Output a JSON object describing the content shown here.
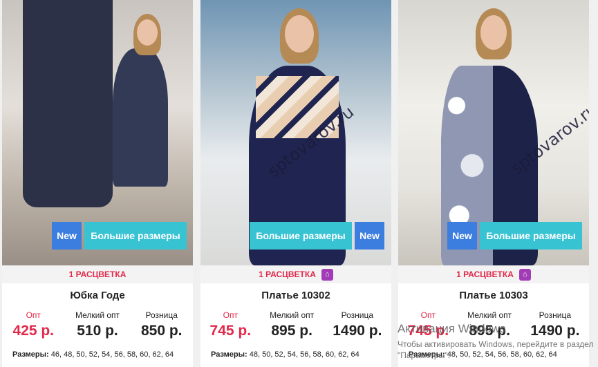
{
  "products": [
    {
      "title": "Юбка Годе",
      "watermark": "",
      "badges": {
        "new": "New",
        "big": "Большие размеры"
      },
      "colors": "1 РАСЦВЕТКА",
      "prices": [
        {
          "label": "Опт",
          "value": "425 р."
        },
        {
          "label": "Мелкий опт",
          "value": "510 р."
        },
        {
          "label": "Розница",
          "value": "850 р."
        }
      ],
      "sizes_label": "Размеры:",
      "sizes": "46, 48, 50, 52, 54, 56, 58, 60, 62, 64"
    },
    {
      "title": "Платье 10302",
      "watermark": "sptovarov.ru",
      "badges": {
        "new": "New",
        "big": "Большие размеры"
      },
      "colors": "1 РАСЦВЕТКА",
      "prices": [
        {
          "label": "Опт",
          "value": "745 р."
        },
        {
          "label": "Мелкий опт",
          "value": "895 р."
        },
        {
          "label": "Розница",
          "value": "1490 р."
        }
      ],
      "sizes_label": "Размеры:",
      "sizes": "48, 50, 52, 54, 56, 58, 60, 62, 64"
    },
    {
      "title": "Платье 10303",
      "watermark": "sptovarov.ru",
      "badges": {
        "new": "New",
        "big": "Большие размеры"
      },
      "colors": "1 РАСЦВЕТКА",
      "prices": [
        {
          "label": "Опт",
          "value": "745 р."
        },
        {
          "label": "Мелкий опт",
          "value": "895 р."
        },
        {
          "label": "Розница",
          "value": "1490 р."
        }
      ],
      "sizes_label": "Размеры:",
      "sizes": "48, 50, 52, 54, 56, 58, 60, 62, 64"
    }
  ],
  "activation": {
    "line1": "Активация Windows",
    "line2": "Чтобы активировать Windows, перейдите в раздел \"Параметры\"."
  },
  "colors": {
    "accent_red": "#e3284a",
    "badge_new": "#3b7ee0",
    "badge_big": "#38c3d3",
    "hanger": "#a23cb6"
  }
}
